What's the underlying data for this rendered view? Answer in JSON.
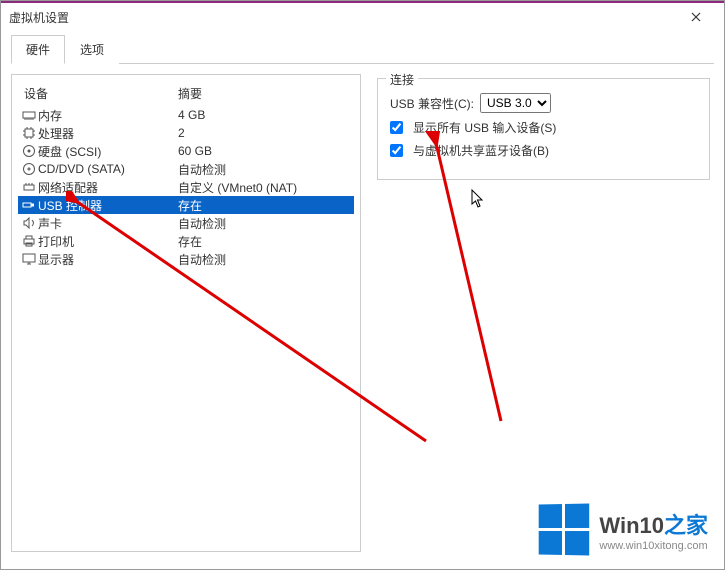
{
  "window": {
    "title": "虚拟机设置",
    "close_icon": "×"
  },
  "tabs": {
    "hardware": "硬件",
    "options": "选项"
  },
  "left_panel": {
    "header_device": "设备",
    "header_summary": "摘要",
    "devices": [
      {
        "icon": "memory",
        "name": "内存",
        "summary": "4 GB"
      },
      {
        "icon": "cpu",
        "name": "处理器",
        "summary": "2"
      },
      {
        "icon": "disk",
        "name": "硬盘 (SCSI)",
        "summary": "60 GB"
      },
      {
        "icon": "cd",
        "name": "CD/DVD (SATA)",
        "summary": "自动检测"
      },
      {
        "icon": "net",
        "name": "网络适配器",
        "summary": "自定义 (VMnet0 (NAT)"
      },
      {
        "icon": "usb",
        "name": "USB 控制器",
        "summary": "存在"
      },
      {
        "icon": "sound",
        "name": "声卡",
        "summary": "自动检测"
      },
      {
        "icon": "printer",
        "name": "打印机",
        "summary": "存在"
      },
      {
        "icon": "display",
        "name": "显示器",
        "summary": "自动检测"
      }
    ],
    "selected_index": 5
  },
  "right_panel": {
    "legend": "连接",
    "compat_label": "USB 兼容性(C):",
    "compat_value": "USB 3.0",
    "show_all_label": "显示所有 USB 输入设备(S)",
    "show_all_checked": true,
    "share_bt_label": "与虚拟机共享蓝牙设备(B)",
    "share_bt_checked": true
  },
  "watermark": {
    "brand_prefix": "Win10",
    "brand_suffix": "之家",
    "url": "www.win10xitong.com"
  }
}
